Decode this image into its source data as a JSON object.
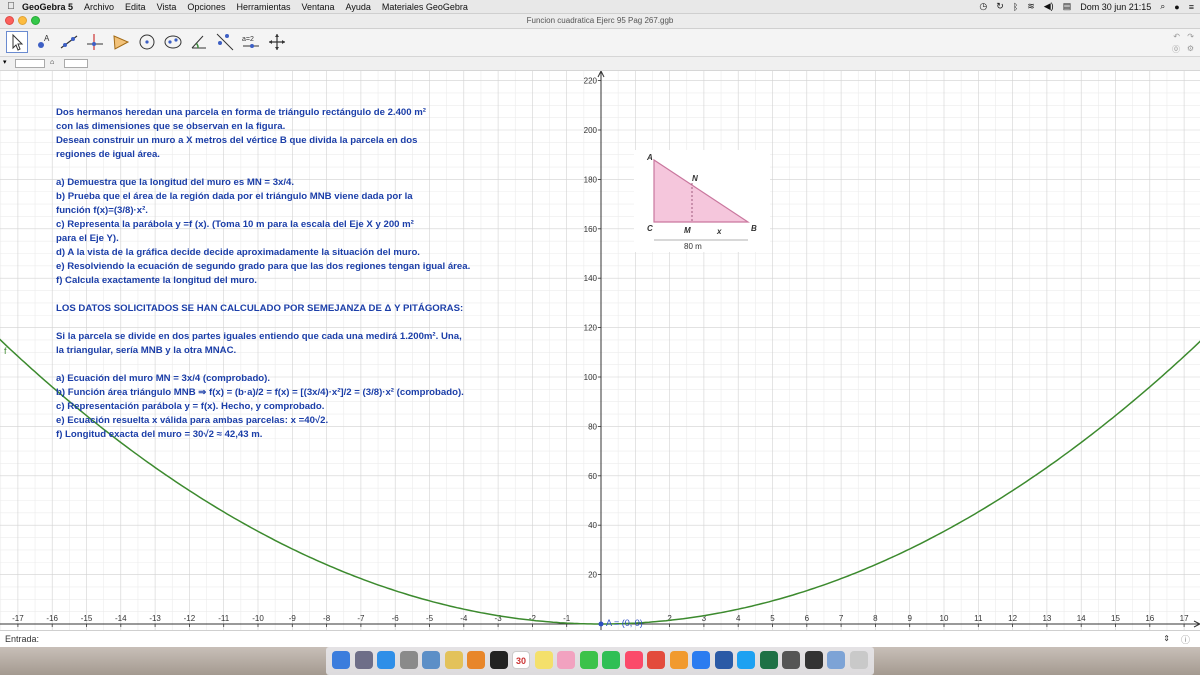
{
  "menubar": {
    "app": "GeoGebra 5",
    "items": [
      "Archivo",
      "Edita",
      "Vista",
      "Opciones",
      "Herramientas",
      "Ventana",
      "Ayuda",
      "Materiales GeoGebra"
    ],
    "datetime": "Dom 30 jun  21:15"
  },
  "window": {
    "title": "Funcion cuadratica Ejerc 95 Pag 267.ggb"
  },
  "toolbar": {
    "tools": [
      "move-tool",
      "point-tool",
      "line-tool",
      "perpendicular-tool",
      "polygon-tool",
      "circle-tool",
      "conic-tool",
      "angle-tool",
      "reflect-tool",
      "slider-tool",
      "move-graphics-tool"
    ],
    "selected": 0,
    "slider_label": "a=2"
  },
  "problem": {
    "lines": [
      "Dos hermanos heredan una parcela en forma de triángulo rectángulo de 2.400 m²",
      "con las dimensiones que se observan en la figura.",
      "Desean construir un muro a X metros del vértice B que divida la parcela en dos",
      "regiones de igual área.",
      "",
      "a) Demuestra que la longitud del muro es MN = 3x/4.",
      "b) Prueba que el área de la región dada por el triángulo MNB viene dada por la",
      "función f(x)=(3/8)·x².",
      "c) Representa la parábola y =f (x). (Toma 10 m para la escala del Eje X y 200 m²",
      "para el Eje Y).",
      "d) A la vista de la gráfica decide decide aproximadamente la situación del muro.",
      "e) Resolviendo la ecuación de segundo grado para que las dos regiones tengan igual área.",
      "f) Calcula exactamente la longitud del muro.",
      "",
      "LOS DATOS SOLICITADOS SE HAN CALCULADO POR SEMEJANZA DE Δ Y PITÁGORAS:",
      "",
      "Si la parcela se divide en dos partes iguales entiendo que cada una medirá 1.200m². Una,",
      "la triangular, sería MNB y la otra MNAC.",
      "",
      "a) Ecuación del muro MN = 3x/4 (comprobado).",
      "b) Función área triángulo MNB ⇒ f(x) = (b·a)/2  =  f(x) = [(3x/4)·x²]/2 = (3/8)·x² (comprobado).",
      "c) Representación parábola y = f(x). Hecho, y comprobado.",
      "e) Ecuación resuelta x válida para ambas parcelas: x =40√2.",
      "f) Longitud exacta del muro = 30√2 ≈ 42,43 m."
    ]
  },
  "figure": {
    "labels": [
      "A",
      "N",
      "C",
      "M",
      "x",
      "B"
    ],
    "dimension": "80 m",
    "fill_color": "#f5c6dc",
    "stroke_color": "#c9779e"
  },
  "graph": {
    "x_ticks": [
      -17,
      -16,
      -15,
      -14,
      -13,
      -12,
      -11,
      -10,
      -9,
      -8,
      -7,
      -6,
      -5,
      -4,
      -3,
      -2,
      -1,
      2,
      3,
      4,
      5,
      6,
      7,
      8,
      9,
      10,
      11,
      12,
      13,
      14,
      15,
      16,
      17
    ],
    "y_ticks": [
      20,
      40,
      60,
      80,
      100,
      120,
      140,
      160,
      180,
      200,
      220
    ],
    "curve_label": "f",
    "point_label": "A = (0, 0)",
    "curve_color": "#3c8a2e",
    "axis_label_color": "#333333"
  },
  "input": {
    "label": "Entrada:"
  },
  "dock": {
    "icons": [
      "finder",
      "launchpad",
      "safari",
      "rocket",
      "preview",
      "notes",
      "vlc",
      "kindle",
      "calendar",
      "stickies",
      "photos",
      "messages",
      "facetime",
      "music",
      "chrome",
      "books",
      "appstore",
      "word",
      "twitter",
      "excel",
      "printer",
      "iterm",
      "geogebra",
      "trash"
    ],
    "calendar_day": "30"
  }
}
